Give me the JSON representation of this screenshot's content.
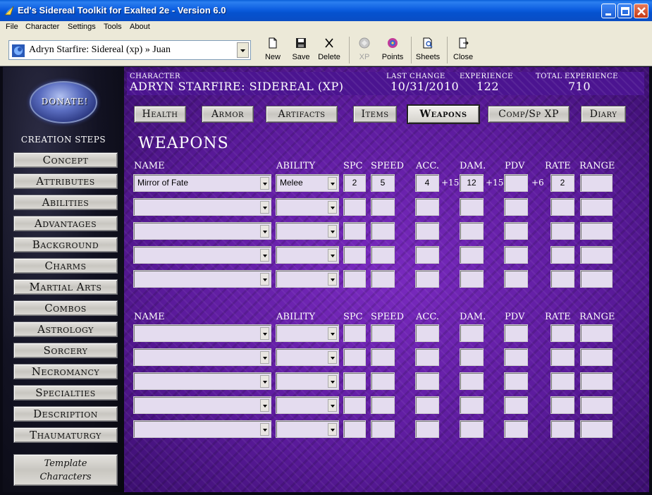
{
  "window": {
    "title": "Ed's Sidereal Toolkit for Exalted 2e - Version 6.0"
  },
  "menu": [
    "File",
    "Character",
    "Settings",
    "Tools",
    "About"
  ],
  "toolbar": {
    "character_select": "Adryn Starfire: Sidereal (xp) » Juan",
    "buttons": {
      "new": "New",
      "save": "Save",
      "delete": "Delete",
      "xp": "XP",
      "points": "Points",
      "sheets": "Sheets",
      "close": "Close"
    }
  },
  "sidebar": {
    "donate": "DONATE!",
    "creation_steps_title": "CREATION STEPS",
    "steps": [
      "Concept",
      "Attributes",
      "Abilities",
      "Advantages",
      "Background",
      "Charms",
      "Martial Arts",
      "Combos",
      "Astrology",
      "Sorcery",
      "Necromancy",
      "Specialties",
      "Description",
      "Thaumaturgy"
    ],
    "template": [
      "Template",
      "Characters"
    ]
  },
  "header": {
    "character_label": "CHARACTER",
    "character_value": "ADRYN STARFIRE: SIDEREAL (XP)",
    "last_change_label": "LAST CHANGE",
    "last_change_value": "10/31/2010",
    "experience_label": "EXPERIENCE",
    "experience_value": "122",
    "total_experience_label": "TOTAL EXPERIENCE",
    "total_experience_value": "710"
  },
  "tabs": [
    "Health",
    "Armor",
    "Artifacts",
    "Items",
    "Weapons",
    "Comp/Sp XP",
    "Diary"
  ],
  "active_tab": "Weapons",
  "section_title": "WEAPONS",
  "columns": {
    "name": "NAME",
    "ability": "ABILITY",
    "spc": "SPC",
    "speed": "SPEED",
    "acc": "ACC.",
    "dam": "DAM.",
    "pdv": "PDV",
    "rate": "RATE",
    "range": "RANGE"
  },
  "weapons_top": [
    {
      "name": "Mirror of Fate",
      "ability": "Melee",
      "spc": "2",
      "speed": "5",
      "acc": "4",
      "acc_mod": "+15",
      "dam": "12",
      "dam_mod": "+15",
      "pdv": "",
      "pdv_mod": "+6",
      "rate": "2",
      "range": ""
    },
    {
      "name": "",
      "ability": "",
      "spc": "",
      "speed": "",
      "acc": "",
      "acc_mod": "",
      "dam": "",
      "dam_mod": "",
      "pdv": "",
      "pdv_mod": "",
      "rate": "",
      "range": ""
    },
    {
      "name": "",
      "ability": "",
      "spc": "",
      "speed": "",
      "acc": "",
      "acc_mod": "",
      "dam": "",
      "dam_mod": "",
      "pdv": "",
      "pdv_mod": "",
      "rate": "",
      "range": ""
    },
    {
      "name": "",
      "ability": "",
      "spc": "",
      "speed": "",
      "acc": "",
      "acc_mod": "",
      "dam": "",
      "dam_mod": "",
      "pdv": "",
      "pdv_mod": "",
      "rate": "",
      "range": ""
    },
    {
      "name": "",
      "ability": "",
      "spc": "",
      "speed": "",
      "acc": "",
      "acc_mod": "",
      "dam": "",
      "dam_mod": "",
      "pdv": "",
      "pdv_mod": "",
      "rate": "",
      "range": ""
    }
  ],
  "weapons_bottom": [
    {
      "name": "",
      "ability": "",
      "spc": "",
      "speed": "",
      "acc": "",
      "dam": "",
      "pdv": "",
      "rate": "",
      "range": ""
    },
    {
      "name": "",
      "ability": "",
      "spc": "",
      "speed": "",
      "acc": "",
      "dam": "",
      "pdv": "",
      "rate": "",
      "range": ""
    },
    {
      "name": "",
      "ability": "",
      "spc": "",
      "speed": "",
      "acc": "",
      "dam": "",
      "pdv": "",
      "rate": "",
      "range": ""
    },
    {
      "name": "",
      "ability": "",
      "spc": "",
      "speed": "",
      "acc": "",
      "dam": "",
      "pdv": "",
      "rate": "",
      "range": ""
    },
    {
      "name": "",
      "ability": "",
      "spc": "",
      "speed": "",
      "acc": "",
      "dam": "",
      "pdv": "",
      "rate": "",
      "range": ""
    }
  ]
}
